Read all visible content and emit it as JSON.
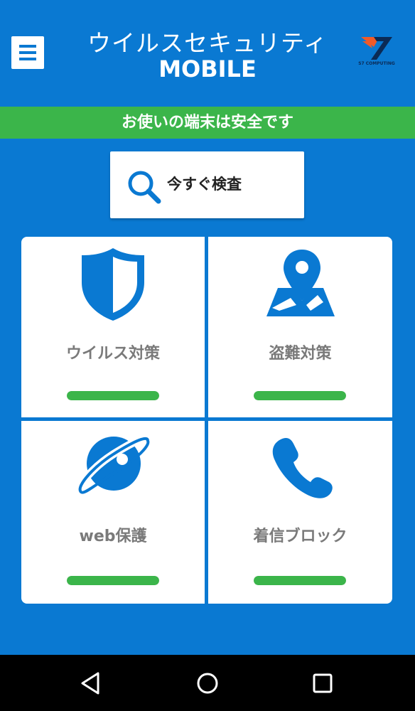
{
  "app": {
    "title_main": "ウイルスセキュリティ",
    "title_sub": "MOBILE",
    "brand_text": "S7 COMPUTING"
  },
  "icons": {
    "menu": "hamburger-menu-icon",
    "brand": "brand-logo-icon",
    "scan": "magnifier-icon",
    "virus": "shield-icon",
    "theft": "map-pin-icon",
    "web": "planet-globe-icon",
    "call": "phone-icon",
    "back": "back-triangle-icon",
    "home": "home-circle-icon",
    "recents": "recents-square-icon"
  },
  "status": {
    "text": "お使いの端末は安全です"
  },
  "scan": {
    "label": "今すぐ検査"
  },
  "features": [
    {
      "label": "ウイルス対策",
      "progress": 1.0
    },
    {
      "label": "盗難対策",
      "progress": 1.0
    },
    {
      "label": "web保護",
      "progress": 1.0
    },
    {
      "label": "着信ブロック",
      "progress": 1.0
    }
  ],
  "colors": {
    "primary_blue": "#0a79d2",
    "safe_green": "#3bb54a",
    "tile_white": "#ffffff",
    "label_gray": "#7a7a7a",
    "brand_orange": "#f05a28"
  }
}
